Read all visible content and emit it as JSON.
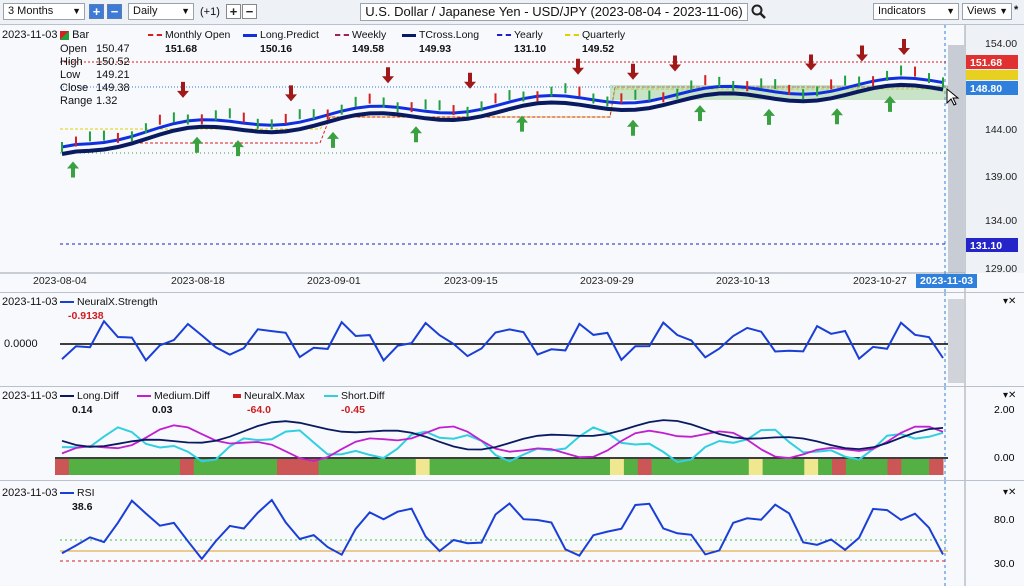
{
  "toolbar": {
    "period": "3 Months",
    "interval": "Daily",
    "offset": "(+1)",
    "plus": "+",
    "minus": "−",
    "title": "U.S. Dollar / Japanese Yen - USD/JPY (2023-08-04 - 2023-11-06)",
    "indicators": "Indicators",
    "views": "Views",
    "star": "*"
  },
  "price_pane": {
    "date": "2023-11-03",
    "bar_label": "Bar",
    "ohlc": [
      {
        "k": "Open",
        "v": "150.47"
      },
      {
        "k": "High",
        "v": "150.52"
      },
      {
        "k": "Low",
        "v": "149.21"
      },
      {
        "k": "Close",
        "v": "149.38"
      },
      {
        "k": "Range",
        "v": "1.32"
      }
    ],
    "legend": [
      {
        "label": "Monthly Open",
        "value": "151.68",
        "color": "#d42020",
        "style": "dash"
      },
      {
        "label": "Long.Predict",
        "value": "150.16",
        "color": "#1030e0",
        "style": "solid"
      },
      {
        "label": "Weekly",
        "value": "149.58",
        "color": "#a02060",
        "style": "dash"
      },
      {
        "label": "TCross.Long",
        "value": "149.93",
        "color": "#0a1a60",
        "style": "solid"
      },
      {
        "label": "Yearly",
        "value": "131.10",
        "color": "#1c20c8",
        "style": "dash"
      },
      {
        "label": "Quarterly",
        "value": "149.52",
        "color": "#e0d000",
        "style": "dash"
      }
    ],
    "y_ticks": [
      "154.00",
      "149.00",
      "144.00",
      "139.00",
      "134.00",
      "129.00"
    ],
    "x_dates": [
      "2023-08-04",
      "2023-08-18",
      "2023-09-01",
      "2023-09-15",
      "2023-09-29",
      "2023-10-13",
      "2023-10-27"
    ],
    "current_date": "2023-11-03",
    "tags": [
      {
        "text": "151.68",
        "color": "#e03030"
      },
      {
        "text": "148.80",
        "color": "#2f7fdc"
      },
      {
        "text": "131.10",
        "color": "#2424c8"
      }
    ]
  },
  "strength_pane": {
    "date": "2023-11-03",
    "label": "NeuralX.Strength",
    "value": "-0.9138",
    "zero_tick": "0.0000"
  },
  "diff_pane": {
    "date": "2023-11-03",
    "legend": [
      {
        "label": "Long.Diff",
        "value": "0.14",
        "color": "#0a1a60"
      },
      {
        "label": "Medium.Diff",
        "value": "0.03",
        "color": "#c020d0"
      },
      {
        "label": "NeuralX.Max",
        "value": "-64.0",
        "color": "#cc2020"
      },
      {
        "label": "Short.Diff",
        "value": "-0.45",
        "color": "#30d0e0"
      }
    ],
    "y_ticks": [
      "2.00",
      "0.00"
    ]
  },
  "rsi_pane": {
    "date": "2023-11-03",
    "label": "RSI",
    "value": "38.6",
    "y_ticks": [
      "80.0",
      "30.0"
    ]
  },
  "close_icon": "▾✕"
}
